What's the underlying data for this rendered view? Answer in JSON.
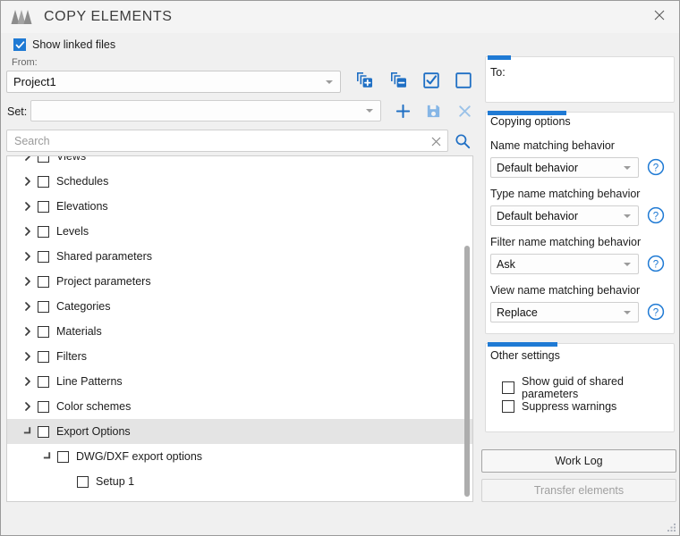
{
  "window": {
    "title": "COPY ELEMENTS",
    "logo_icon": "mountains-logo-icon",
    "close_icon": "close-icon"
  },
  "toolbar": {
    "show_linked_files_label": "Show linked files",
    "show_linked_files_checked": true,
    "from_label": "From:",
    "from_value": "Project1",
    "set_label": "Set:",
    "set_value": "",
    "search_placeholder": "Search",
    "search_value": "",
    "icons": {
      "add_set": "copy-add-icon",
      "remove_set": "copy-remove-icon",
      "check_all": "check-all-icon",
      "uncheck_all": "uncheck-all-icon",
      "plus": "plus-icon",
      "save": "save-icon",
      "delete": "close-x-icon",
      "clear_search": "clear-x-icon",
      "search": "search-icon"
    }
  },
  "tree": {
    "items": [
      {
        "label": "Views",
        "indent": 0,
        "state": "collapsed",
        "checked": false,
        "selected": false
      },
      {
        "label": "Schedules",
        "indent": 0,
        "state": "collapsed",
        "checked": false,
        "selected": false
      },
      {
        "label": "Elevations",
        "indent": 0,
        "state": "collapsed",
        "checked": false,
        "selected": false
      },
      {
        "label": "Levels",
        "indent": 0,
        "state": "collapsed",
        "checked": false,
        "selected": false
      },
      {
        "label": "Shared parameters",
        "indent": 0,
        "state": "collapsed",
        "checked": false,
        "selected": false
      },
      {
        "label": "Project parameters",
        "indent": 0,
        "state": "collapsed",
        "checked": false,
        "selected": false
      },
      {
        "label": "Categories",
        "indent": 0,
        "state": "collapsed",
        "checked": false,
        "selected": false
      },
      {
        "label": "Materials",
        "indent": 0,
        "state": "collapsed",
        "checked": false,
        "selected": false
      },
      {
        "label": "Filters",
        "indent": 0,
        "state": "collapsed",
        "checked": false,
        "selected": false
      },
      {
        "label": "Line Patterns",
        "indent": 0,
        "state": "collapsed",
        "checked": false,
        "selected": false
      },
      {
        "label": "Color schemes",
        "indent": 0,
        "state": "collapsed",
        "checked": false,
        "selected": false
      },
      {
        "label": "Export Options",
        "indent": 0,
        "state": "expanded",
        "checked": false,
        "selected": true
      },
      {
        "label": "DWG/DXF export options",
        "indent": 1,
        "state": "expanded",
        "checked": false,
        "selected": false
      },
      {
        "label": "Setup 1",
        "indent": 2,
        "state": "leaf",
        "checked": false,
        "selected": false
      }
    ]
  },
  "right": {
    "to": {
      "label": "To:",
      "value": ""
    },
    "copying_options": {
      "title": "Copying options",
      "rows": [
        {
          "label": "Name matching behavior",
          "value": "Default behavior",
          "help_icon": "help-circle-icon"
        },
        {
          "label": "Type name matching behavior",
          "value": "Default behavior",
          "help_icon": "help-circle-icon"
        },
        {
          "label": "Filter name matching behavior",
          "value": "Ask",
          "help_icon": "help-circle-icon"
        },
        {
          "label": "View name matching behavior",
          "value": "Replace",
          "help_icon": "help-circle-icon"
        }
      ]
    },
    "other_settings": {
      "title": "Other settings",
      "checkboxes": [
        {
          "label": "Show guid of shared parameters",
          "checked": false
        },
        {
          "label": "Suppress warnings",
          "checked": false
        }
      ]
    },
    "buttons": {
      "work_log": "Work Log",
      "transfer_elements": "Transfer elements",
      "transfer_enabled": false
    }
  },
  "colors": {
    "accent": "#1f7ad4",
    "window_bg": "#f0f0f0",
    "panel_bg": "#ffffff",
    "selection": "#e4e4e4",
    "disabled_text": "#a0a0a0"
  }
}
